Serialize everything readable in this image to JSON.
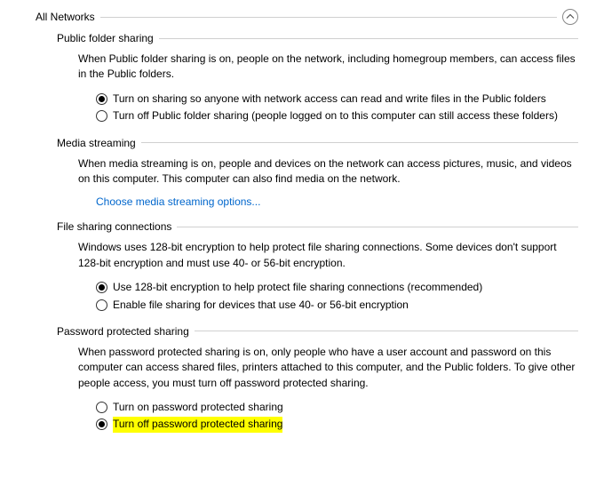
{
  "category_title": "All Networks",
  "sections": {
    "public_folder": {
      "title": "Public folder sharing",
      "desc": "When Public folder sharing is on, people on the network, including homegroup members, can access files in the Public folders.",
      "opts": [
        "Turn on sharing so anyone with network access can read and write files in the Public folders",
        "Turn off Public folder sharing (people logged on to this computer can still access these folders)"
      ]
    },
    "media": {
      "title": "Media streaming",
      "desc": "When media streaming is on, people and devices on the network can access pictures, music, and videos on this computer. This computer can also find media on the network.",
      "link": "Choose media streaming options..."
    },
    "file_sharing": {
      "title": "File sharing connections",
      "desc": "Windows uses 128-bit encryption to help protect file sharing connections. Some devices don't support 128-bit encryption and must use 40- or 56-bit encryption.",
      "opts": [
        "Use 128-bit encryption to help protect file sharing connections (recommended)",
        "Enable file sharing for devices that use 40- or 56-bit encryption"
      ]
    },
    "password": {
      "title": "Password protected sharing",
      "desc": "When password protected sharing is on, only people who have a user account and password on this computer can access shared files, printers attached to this computer, and the Public folders. To give other people access, you must turn off password protected sharing.",
      "opts": [
        "Turn on password protected sharing",
        "Turn off password protected sharing"
      ]
    }
  }
}
